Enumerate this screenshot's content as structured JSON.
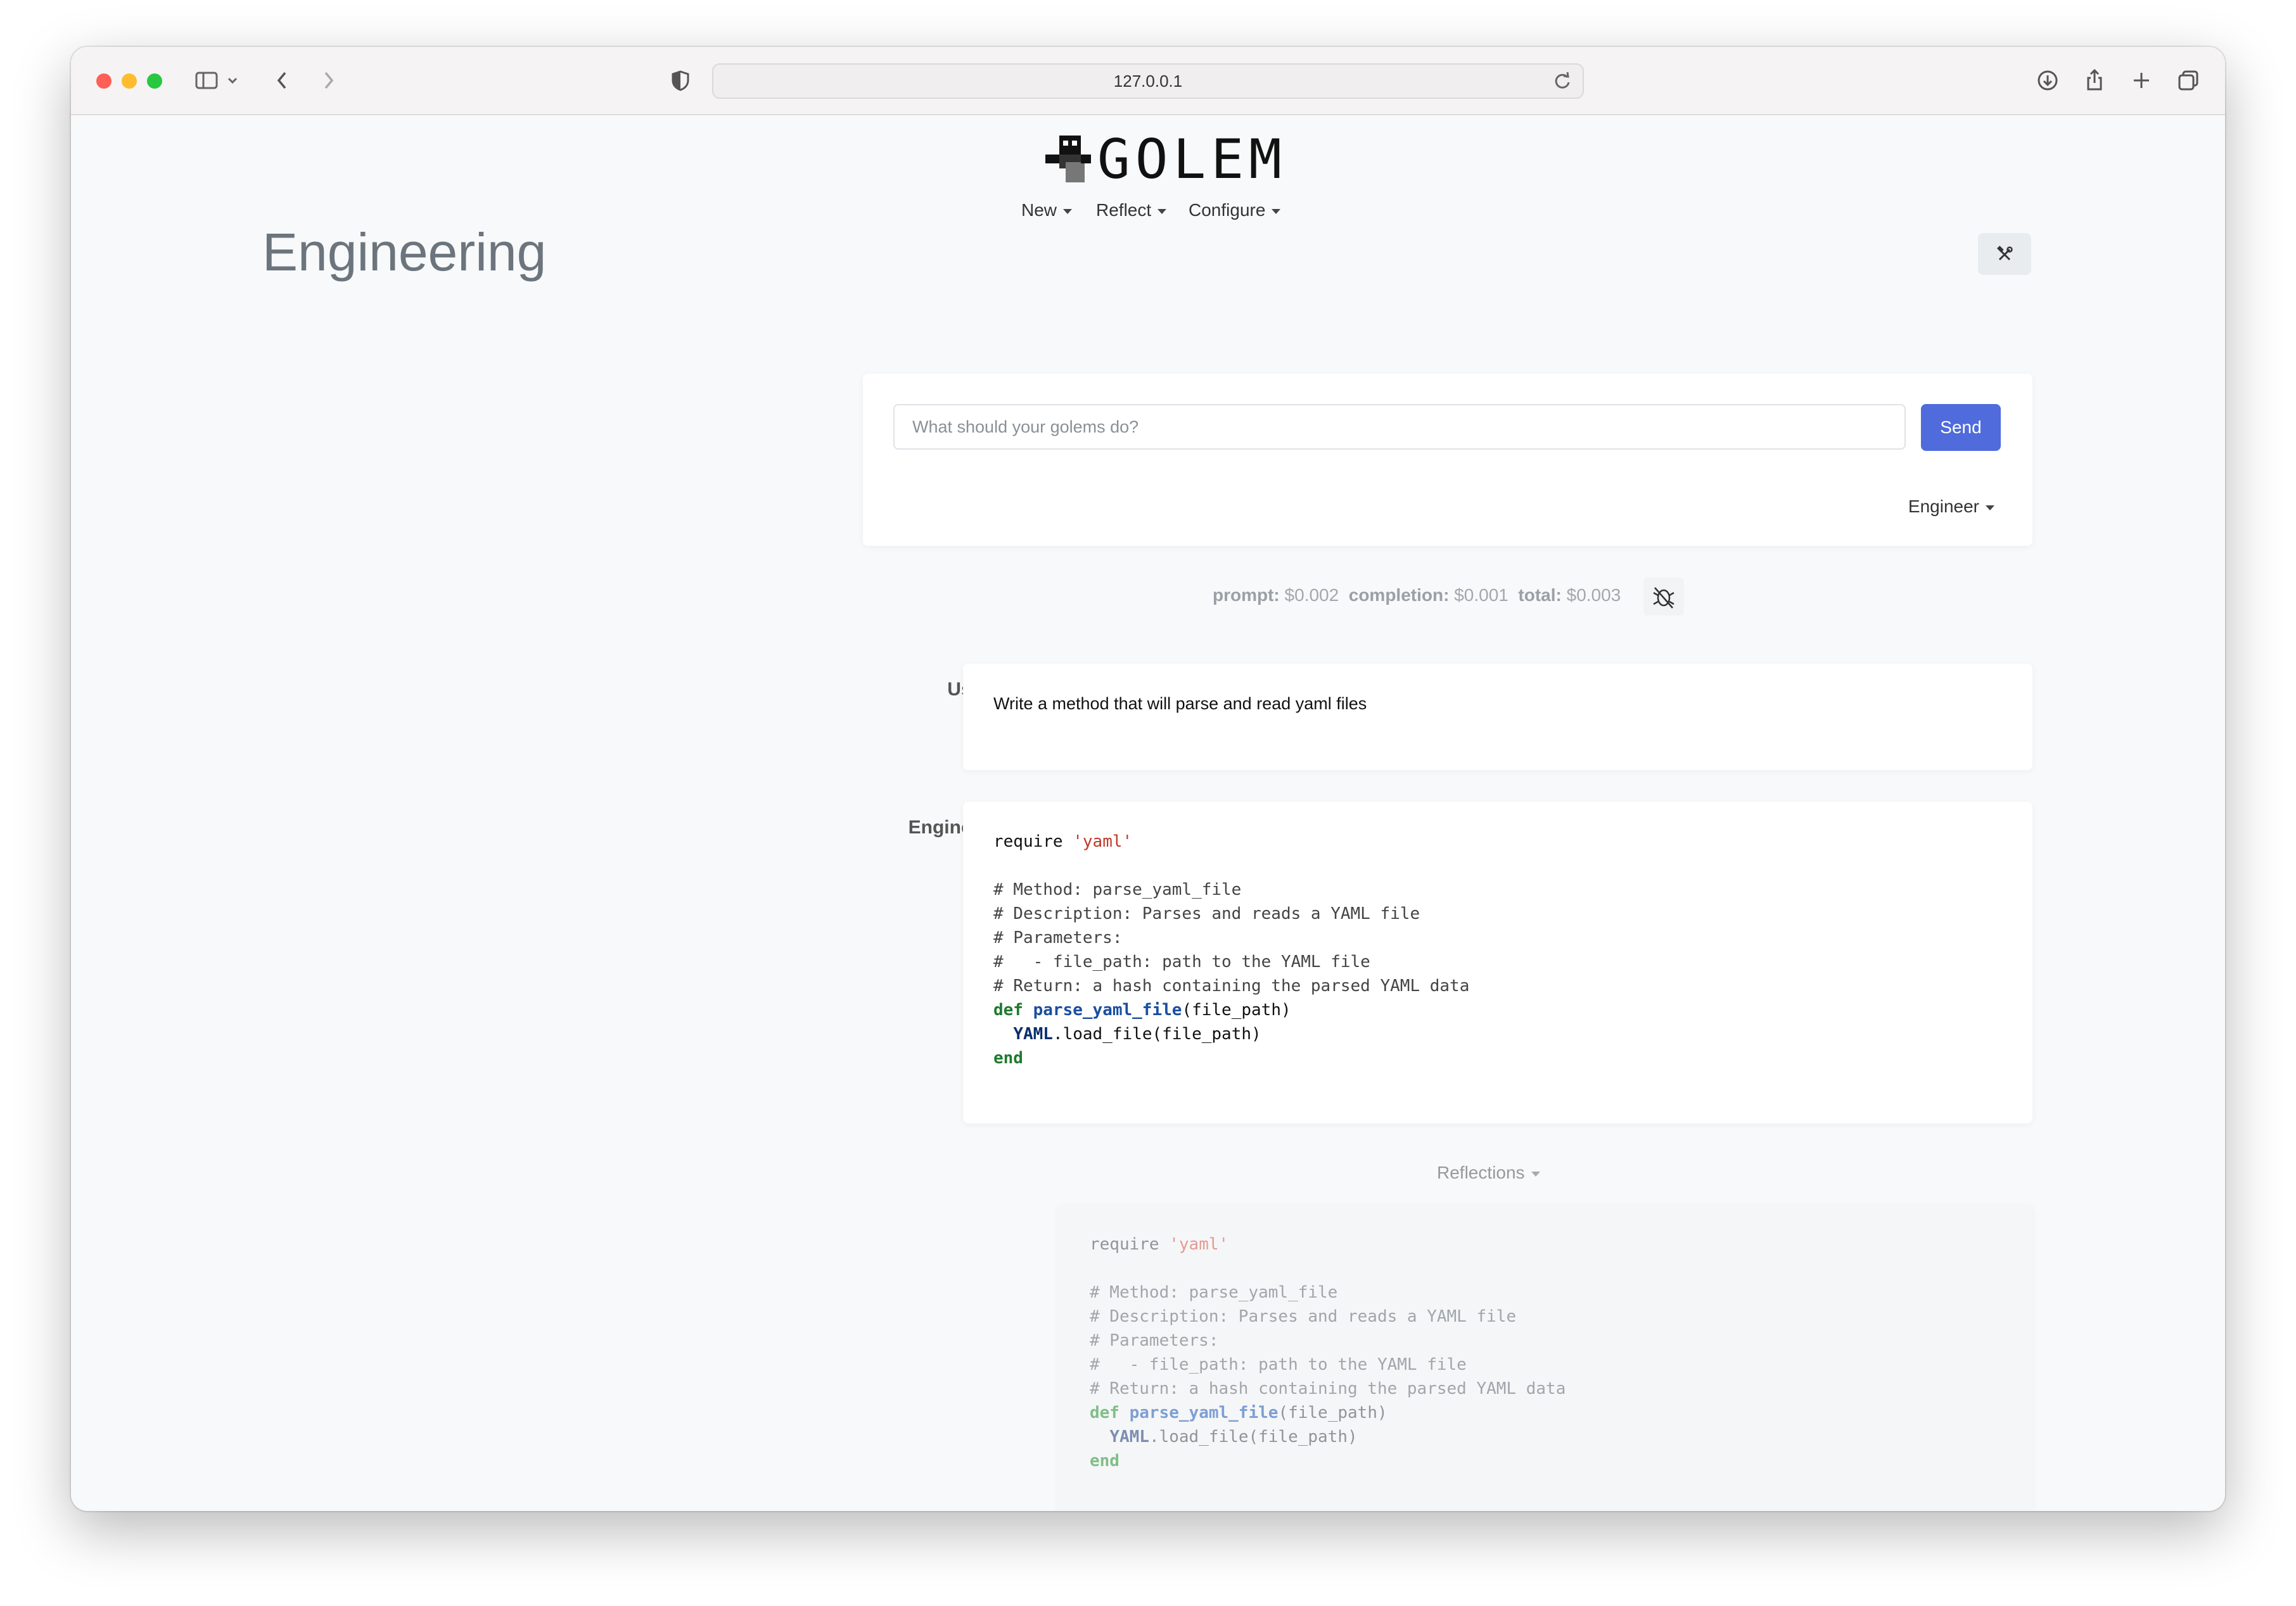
{
  "browser": {
    "url": "127.0.0.1"
  },
  "app": {
    "logo_text": "GOLEM",
    "nav": [
      {
        "label": "New"
      },
      {
        "label": "Reflect"
      },
      {
        "label": "Configure"
      }
    ],
    "page_title": "Engineering"
  },
  "prompt": {
    "placeholder": "What should your golems do?",
    "send_label": "Send",
    "agent_select": "Engineer"
  },
  "cost": {
    "prompt_label": "prompt:",
    "prompt_value": "$0.002",
    "completion_label": "completion:",
    "completion_value": "$0.001",
    "total_label": "total:",
    "total_value": "$0.003"
  },
  "messages": [
    {
      "role": "User",
      "text": "Write a method that will parse and read yaml files"
    },
    {
      "role": "Engineer"
    }
  ],
  "code": {
    "l1_kw": "require",
    "l1_str": "'yaml'",
    "c1": "# Method: parse_yaml_file",
    "c2": "# Description: Parses and reads a YAML file",
    "c3": "# Parameters:",
    "c4": "#   - file_path: path to the YAML file",
    "c5": "# Return: a hash containing the parsed YAML data",
    "def_kw": "def",
    "def_name": "parse_yaml_file",
    "def_args": "(file_path)",
    "body_cls": "YAML",
    "body_rest": ".load_file(file_path)",
    "end_kw": "end"
  },
  "reflections": {
    "label": "Reflections"
  }
}
